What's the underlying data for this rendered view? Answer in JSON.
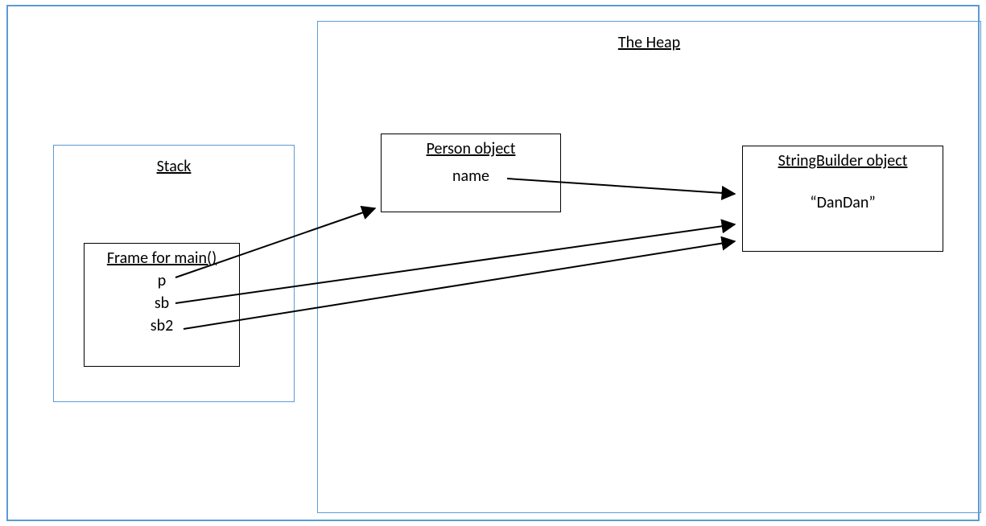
{
  "heap": {
    "title": "The Heap",
    "person": {
      "title": "Person object",
      "field": "name"
    },
    "stringbuilder": {
      "title": "StringBuilder object",
      "value": "“DanDan”"
    }
  },
  "stack": {
    "title": "Stack",
    "frame": {
      "title": "Frame for main()",
      "var1": "p",
      "var2": "sb",
      "var3": "sb2"
    }
  }
}
